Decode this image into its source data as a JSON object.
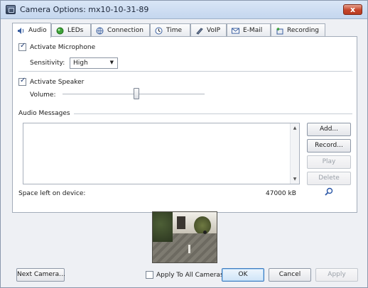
{
  "window": {
    "title": "Camera Options: mx10-10-31-89",
    "close_label": "x"
  },
  "tabs": [
    {
      "label": "Audio",
      "icon": "speaker-icon"
    },
    {
      "label": "LEDs",
      "icon": "led-icon"
    },
    {
      "label": "Connection",
      "icon": "connection-icon"
    },
    {
      "label": "Time",
      "icon": "clock-icon"
    },
    {
      "label": "VoIP",
      "icon": "phone-icon"
    },
    {
      "label": "E-Mail",
      "icon": "email-icon"
    },
    {
      "label": "Recording",
      "icon": "recording-icon"
    }
  ],
  "audio": {
    "microphone": {
      "label": "Activate Microphone",
      "checked": true
    },
    "sensitivity": {
      "label": "Sensitivity:",
      "value": "High"
    },
    "speaker": {
      "label": "Activate Speaker",
      "checked": true
    },
    "volume": {
      "label": "Volume:",
      "level": 0.52
    },
    "messages": {
      "heading": "Audio Messages",
      "buttons": {
        "add": "Add...",
        "record": "Record...",
        "play": "Play",
        "delete": "Delete"
      }
    },
    "space": {
      "label": "Space left on device:",
      "value": "47000 kB"
    }
  },
  "footer": {
    "next_camera": "Next Camera...",
    "apply_all": "Apply To All Cameras",
    "ok": "OK",
    "cancel": "Cancel",
    "apply": "Apply"
  },
  "colors": {
    "accent": "#3d7bbf",
    "close": "#c5452a",
    "panel": "#ffffff",
    "chrome": "#eef0f4"
  }
}
